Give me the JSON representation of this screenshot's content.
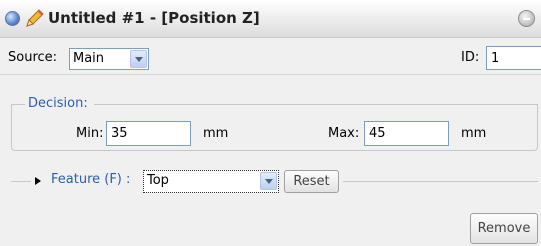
{
  "window": {
    "title": "Untitled #1 - [Position Z]"
  },
  "source": {
    "label": "Source:",
    "value": "Main"
  },
  "id_field": {
    "label": "ID:",
    "value": "1"
  },
  "decision": {
    "legend": "Decision:",
    "min_label": "Min:",
    "min_value": "35",
    "min_unit": "mm",
    "max_label": "Max:",
    "max_value": "45",
    "max_unit": "mm"
  },
  "feature": {
    "label": "Feature (F) :",
    "value": "Top",
    "reset_label": "Reset"
  },
  "remove_label": "Remove",
  "colors": {
    "accent": "#2a5fb0",
    "titlebar": "#dcdcdc",
    "background": "#f0f0f0"
  },
  "icons": [
    "window-icon",
    "pencil-icon",
    "collapse-icon",
    "chevron-down-icon",
    "expand-arrow-icon"
  ]
}
